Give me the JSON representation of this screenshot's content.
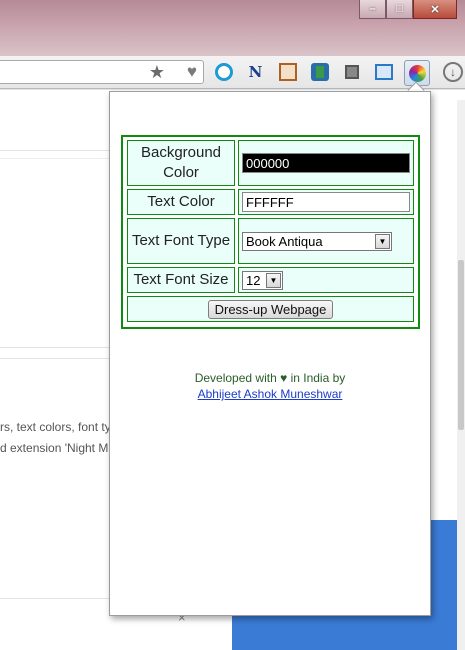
{
  "window": {
    "minimize": "–",
    "maximize": "□",
    "close": "✕"
  },
  "toolbar": {
    "extensions": [
      "ring-icon",
      "onenote-icon",
      "calendar-icon",
      "evernote-icon",
      "window-icon",
      "stack-icon",
      "color-wheel-icon",
      "download-icon"
    ]
  },
  "background_page": {
    "snippet_1": "rs, text colors, font ty",
    "snippet_2": "d extension 'Night M",
    "close_glyph": "×"
  },
  "popup": {
    "rows": [
      {
        "label": "Background Color",
        "value": "000000"
      },
      {
        "label": "Text Color",
        "value": "FFFFFF"
      },
      {
        "label": "Text Font Type",
        "value": "Book Antiqua"
      },
      {
        "label": "Text Font Size",
        "value": "12"
      }
    ],
    "button_label": "Dress-up Webpage",
    "footer_prefix": "Developed with",
    "footer_heart": "♥",
    "footer_suffix": "in India by",
    "author": "Abhijeet Ashok Muneshwar"
  },
  "colors": {
    "accent_border": "#118a11",
    "cell_bg": "#eafffa",
    "link": "#1a3cc8"
  }
}
